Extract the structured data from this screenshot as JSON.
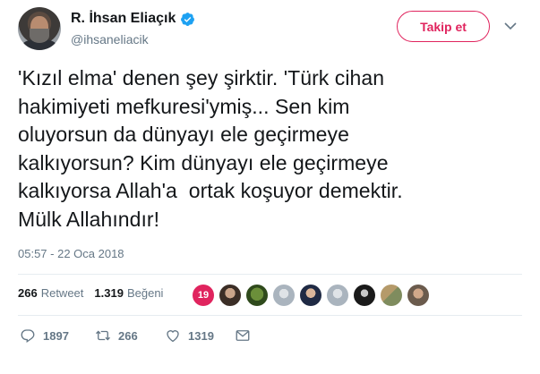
{
  "author": {
    "display_name": "R. İhsan Eliaçık",
    "handle": "@ihsaneliacik",
    "verified": true
  },
  "follow_button": {
    "label": "Takip et"
  },
  "tweet": {
    "text": "'Kızıl elma' denen şey şirktir. 'Türk cihan\nhakimiyeti mefkuresi'ymiş... Sen kim\noluyorsun da dünyayı ele geçirmeye\nkalkıyorsun? Kim dünyayı ele geçirmeye\nkalkıyorsa Allah'a  ortak koşuyor demektir.\nMülk Allahındır!",
    "timestamp": "05:57 - 22 Oca 2018"
  },
  "stats": {
    "retweets_count": "266",
    "retweets_label": "Retweet",
    "likes_count": "1.319",
    "likes_label": "Beğeni"
  },
  "likers": {
    "badge_count": "19",
    "avatars": [
      "liker-1",
      "liker-2",
      "liker-3",
      "liker-4",
      "liker-5",
      "liker-6",
      "liker-7",
      "liker-8",
      "liker-9"
    ]
  },
  "actions": {
    "reply_count": "1897",
    "retweet_count": "266",
    "like_count": "1319"
  },
  "colors": {
    "accent": "#e0245e",
    "verified": "#1da1f2",
    "muted": "#657786",
    "text": "#14171a"
  },
  "icons": {
    "verified": "verified-badge-icon",
    "caret": "chevron-down-icon",
    "reply": "reply-icon",
    "retweet": "retweet-icon",
    "like": "heart-icon",
    "dm": "envelope-icon"
  }
}
